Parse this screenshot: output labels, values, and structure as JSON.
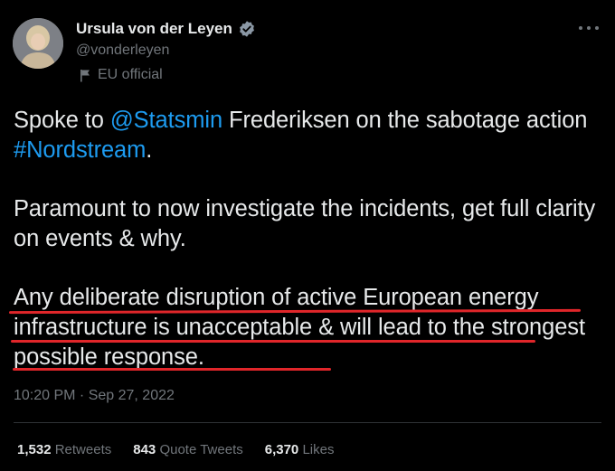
{
  "author": {
    "display_name": "Ursula von der Leyen",
    "handle": "@vonderleyen",
    "affiliation": "EU official",
    "verified_color": "#1d9bf0"
  },
  "tweet": {
    "p1": {
      "a": "Spoke to ",
      "mention": "@Statsmin",
      "b": " Frederiksen on the sabotage action ",
      "hashtag": "#Nordstream",
      "c": "."
    },
    "p2": "Paramount to now investigate the incidents, get full clarity on events & why.",
    "p3": "Any deliberate disruption of active European energy infrastructure is unacceptable & will lead to the strongest possible response.",
    "timestamp": "10:20 PM · Sep 27, 2022"
  },
  "stats": {
    "retweets_count": "1,532",
    "retweets_label": "Retweets",
    "quotes_count": "843",
    "quotes_label": "Quote Tweets",
    "likes_count": "6,370",
    "likes_label": "Likes"
  },
  "colors": {
    "background": "#000000",
    "link": "#1d9bf0",
    "muted": "#71767b",
    "underline": "#e0262a"
  }
}
